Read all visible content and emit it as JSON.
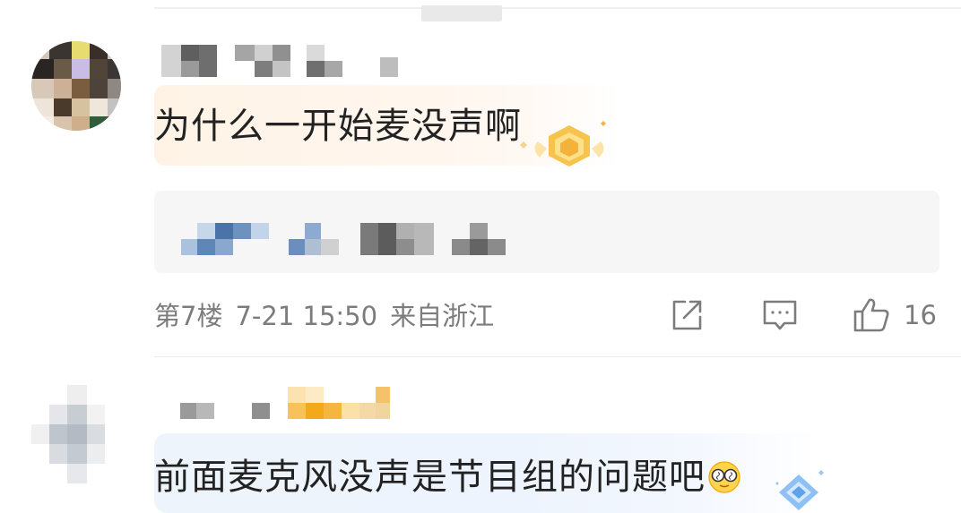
{
  "comment_1": {
    "text": "为什么一开始麦没声啊",
    "floor": "第7楼",
    "datetime": "7-21 15:50",
    "location": "来自浙江",
    "like_count": "16",
    "icons": [
      "share-icon",
      "reply-icon",
      "thumbs-up-icon"
    ],
    "badge": "gold-fan-badge-icon"
  },
  "comment_2": {
    "text": "前面麦克风没声是节目组的问题吧",
    "emoji": "dizzy-glasses-emoji-icon",
    "badge": "blue-diamond-badge-icon"
  },
  "colors": {
    "text": "#222222",
    "meta": "#7c7c7c",
    "bubble_orange": "#fff3e6",
    "bubble_blue": "#eef4fc",
    "quote_bg": "#f6f6f6"
  }
}
